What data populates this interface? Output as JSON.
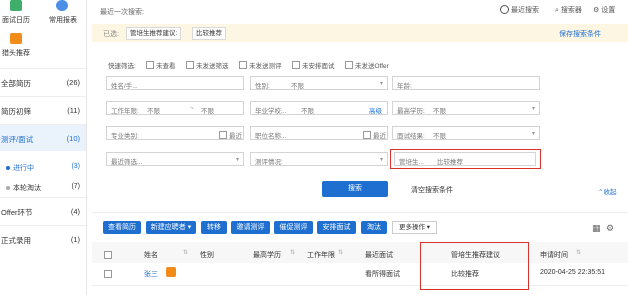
{
  "sidebar": {
    "top_icons": [
      {
        "icon": "calendar-icon",
        "label": "面试日历",
        "color": "#3fae6a"
      },
      {
        "icon": "report-chart-icon",
        "label": "常用报表",
        "color": "#4a8ee6"
      },
      {
        "icon": "headhunt-icon",
        "label": "猎头推荐",
        "color": "#f08c1a"
      }
    ],
    "items": [
      {
        "label": "全部简历",
        "count": "(26)"
      },
      {
        "label": "简历初筛",
        "count": "(11)"
      },
      {
        "label": "测评/面试",
        "count": "(10)"
      },
      {
        "label": "Offer环节",
        "count": "(4)"
      },
      {
        "label": "正式录用",
        "count": "(1)"
      }
    ],
    "sub_items": [
      {
        "label": "进行中",
        "count": "(3)"
      },
      {
        "label": "本轮淘汰",
        "count": "(7)"
      }
    ]
  },
  "header": {
    "recent_search": "最近一次搜索:",
    "recent_search_btn": "最近搜索",
    "searcher_btn": "搜索器",
    "settings_btn": "设置"
  },
  "selected_bar": {
    "label": "已选:",
    "tags": [
      "管培生推荐建议:",
      "比较推荐"
    ],
    "save": "保存搜索条件"
  },
  "quick_filter": {
    "label": "快速筛选:",
    "options": [
      "未查看",
      "未发送筛选",
      "未发送测评",
      "未安排面试",
      "未发送Offer"
    ]
  },
  "filters": {
    "name": "姓名/手...",
    "gender": "性别:",
    "gender_val": "不限",
    "age": "年龄:",
    "work_years": "工作年限:",
    "work_from": "不限",
    "to": "~",
    "work_to": "不限",
    "school": "毕业学校...",
    "school_val": "不限",
    "advanced": "高级",
    "education": "最高学历:",
    "education_val": "不限",
    "major": "专业类别:",
    "latest": "最近",
    "position": "职位名称...",
    "interview_result": "面试结果:",
    "interview_val": "不限",
    "recent_filter": "最近筛选...",
    "assessment": "测评情况:",
    "mgmt": "管培生...",
    "mgmt_val": "比较推荐"
  },
  "actions": {
    "search": "搜索",
    "clear": "清空搜索条件",
    "collapse": "收起"
  },
  "toolbar": {
    "buttons": [
      "查看简历",
      "新建应聘者",
      "转移",
      "邀请测评",
      "催促测评",
      "安排面试",
      "淘汰"
    ],
    "more": "更多操作"
  },
  "table": {
    "headers": [
      "姓名",
      "性别",
      "最高学历",
      "工作年限",
      "最近面试",
      "管培生推荐建议",
      "申请时间"
    ],
    "rows": [
      {
        "name": "张三",
        "gender": "",
        "education": "",
        "years": "",
        "interview": "看所得面试",
        "recommend": "比较推荐",
        "time": "2020-04-25 22:35:51"
      }
    ]
  },
  "colors": {
    "accent": "#1f6fd1",
    "highlight": "#d9342b"
  }
}
